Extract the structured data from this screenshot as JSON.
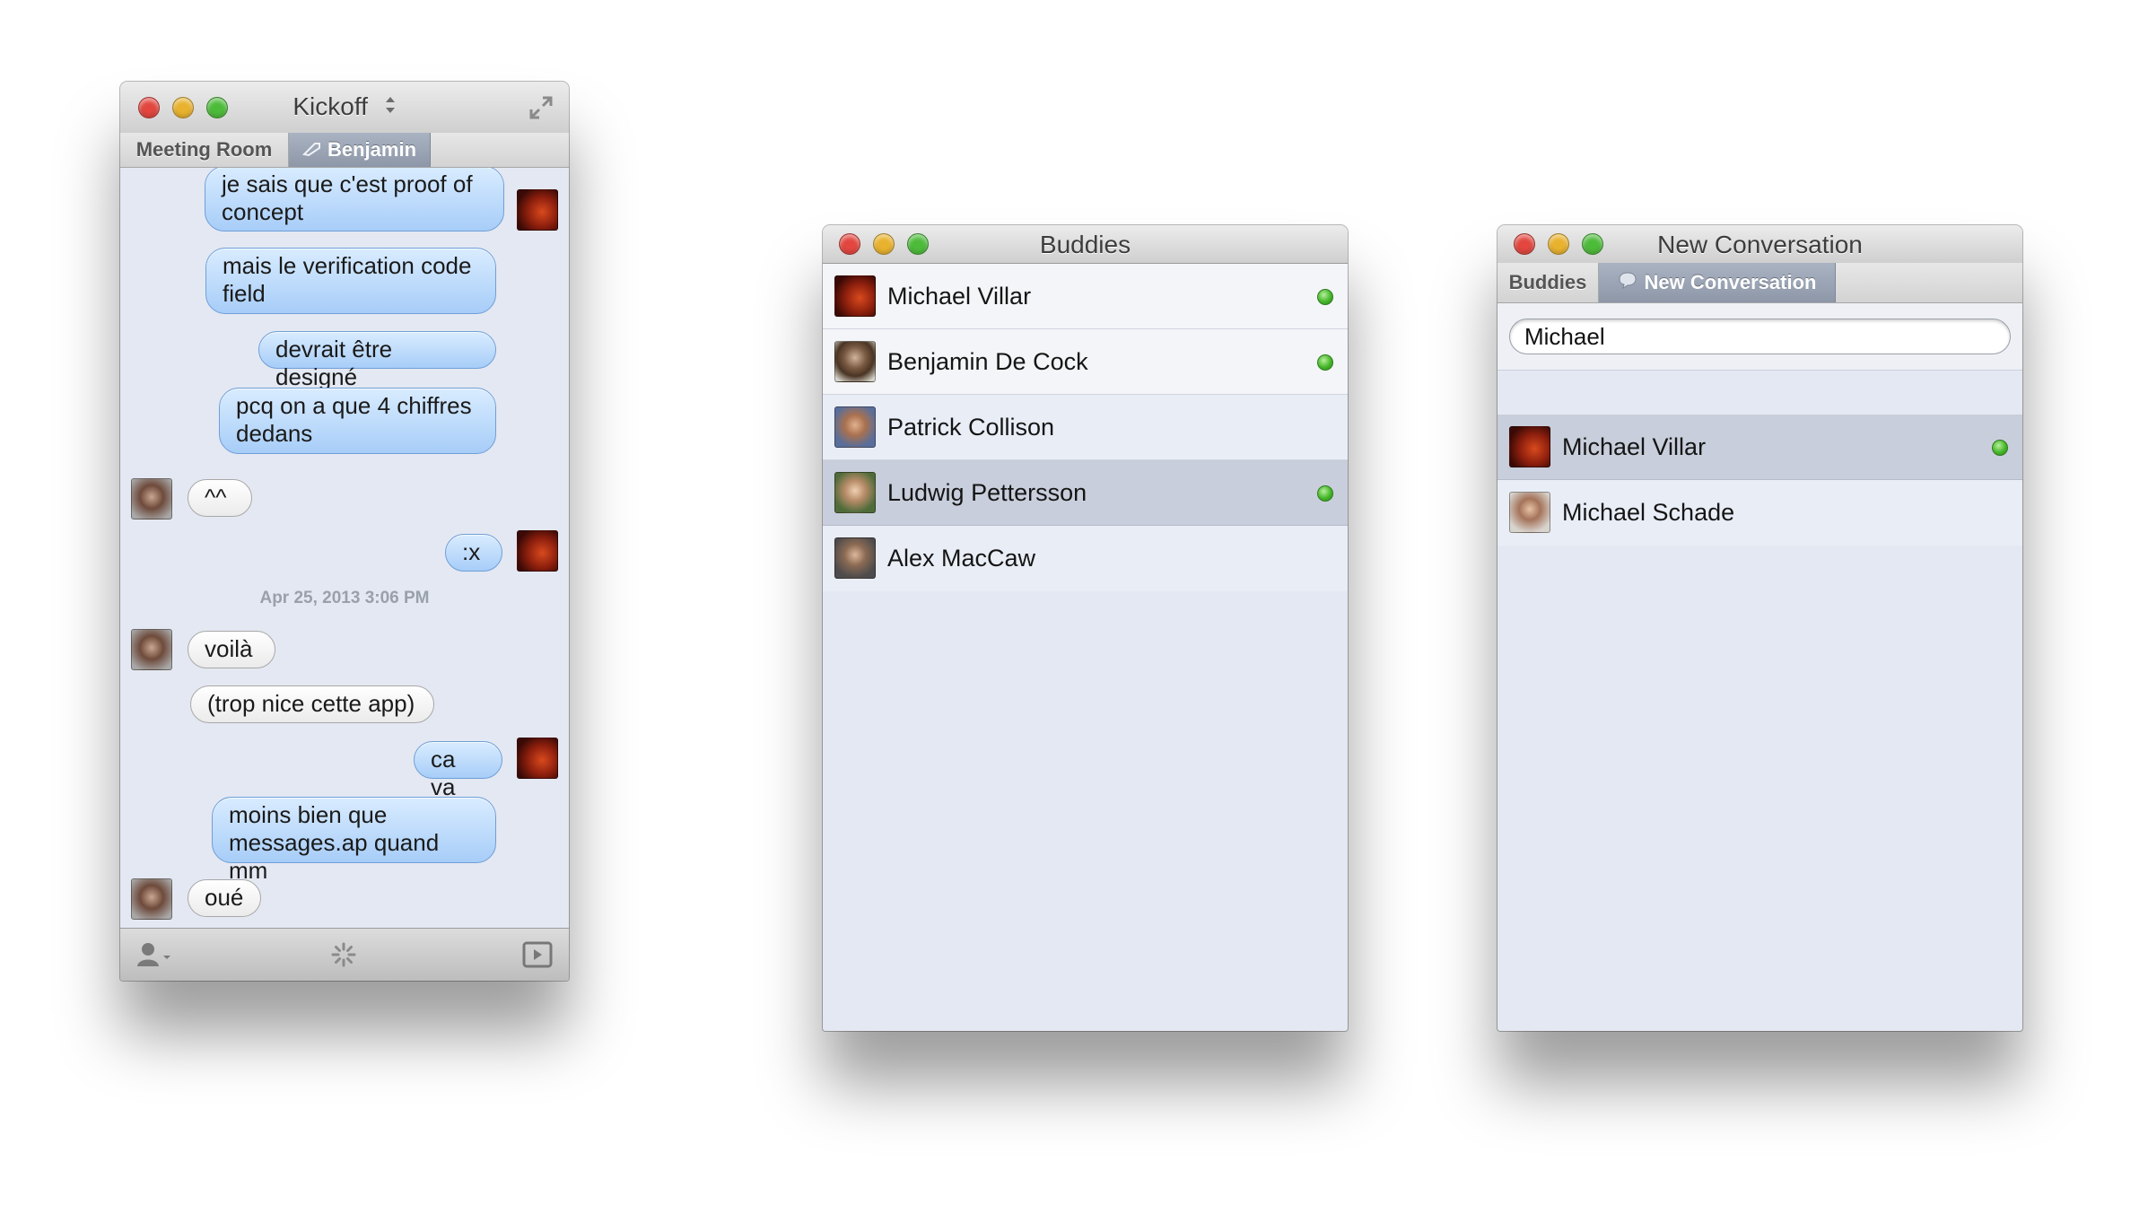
{
  "chat_window": {
    "title": "Kickoff",
    "tabs": [
      {
        "label": "Meeting Room",
        "active": false
      },
      {
        "label": "Benjamin",
        "active": true
      }
    ],
    "messages": [
      {
        "side": "right",
        "style": "blue",
        "text": "je sais que c'est proof of\nconcept",
        "avatar": "michael-villar"
      },
      {
        "side": "right",
        "style": "blue",
        "text": "mais le verification code\nfield"
      },
      {
        "side": "right",
        "style": "blue",
        "text": "devrait être designé"
      },
      {
        "side": "right",
        "style": "blue",
        "text": "pcq on a que 4 chiffres\ndedans"
      },
      {
        "side": "left",
        "style": "white",
        "text": "^^",
        "avatar": "friend"
      },
      {
        "side": "right",
        "style": "blue",
        "text": ":x",
        "avatar": "michael-villar"
      },
      {
        "side": "left",
        "style": "white",
        "text": "voilà",
        "avatar": "friend"
      },
      {
        "side": "left",
        "style": "white",
        "text": "(trop nice cette app)"
      },
      {
        "side": "right",
        "style": "blue",
        "text": "ca va",
        "avatar": "michael-villar"
      },
      {
        "side": "right",
        "style": "blue",
        "text": "moins bien que\nmessages.ap quand mm"
      },
      {
        "side": "left",
        "style": "white",
        "text": "oué",
        "avatar": "friend"
      }
    ],
    "timestamp": "Apr 25, 2013 3:06 PM",
    "toolbar_icons": [
      "add-person-icon",
      "spinner-icon",
      "media-toggle-icon"
    ]
  },
  "buddies_window": {
    "title": "Buddies",
    "buddies": [
      {
        "name": "Michael Villar",
        "online": true,
        "selected": false
      },
      {
        "name": "Benjamin De Cock",
        "online": true,
        "selected": false
      },
      {
        "name": "Patrick Collison",
        "online": false,
        "selected": false
      },
      {
        "name": "Ludwig Pettersson",
        "online": true,
        "selected": true
      },
      {
        "name": "Alex MacCaw",
        "online": false,
        "selected": false
      }
    ]
  },
  "new_conversation_window": {
    "title": "New Conversation",
    "tabs": [
      {
        "label": "Buddies",
        "active": false
      },
      {
        "label": "New Conversation",
        "active": true
      }
    ],
    "search": {
      "value": "Michael",
      "placeholder": ""
    },
    "results": [
      {
        "name": "Michael Villar",
        "online": true,
        "selected": true
      },
      {
        "name": "Michael Schade",
        "online": false,
        "selected": false
      }
    ]
  },
  "colors": {
    "window_bg": "#e4e8f2",
    "active_tab": "#97a1b2",
    "online_dot": "#46b52a",
    "blue_bubble": "#b8d8fb"
  }
}
